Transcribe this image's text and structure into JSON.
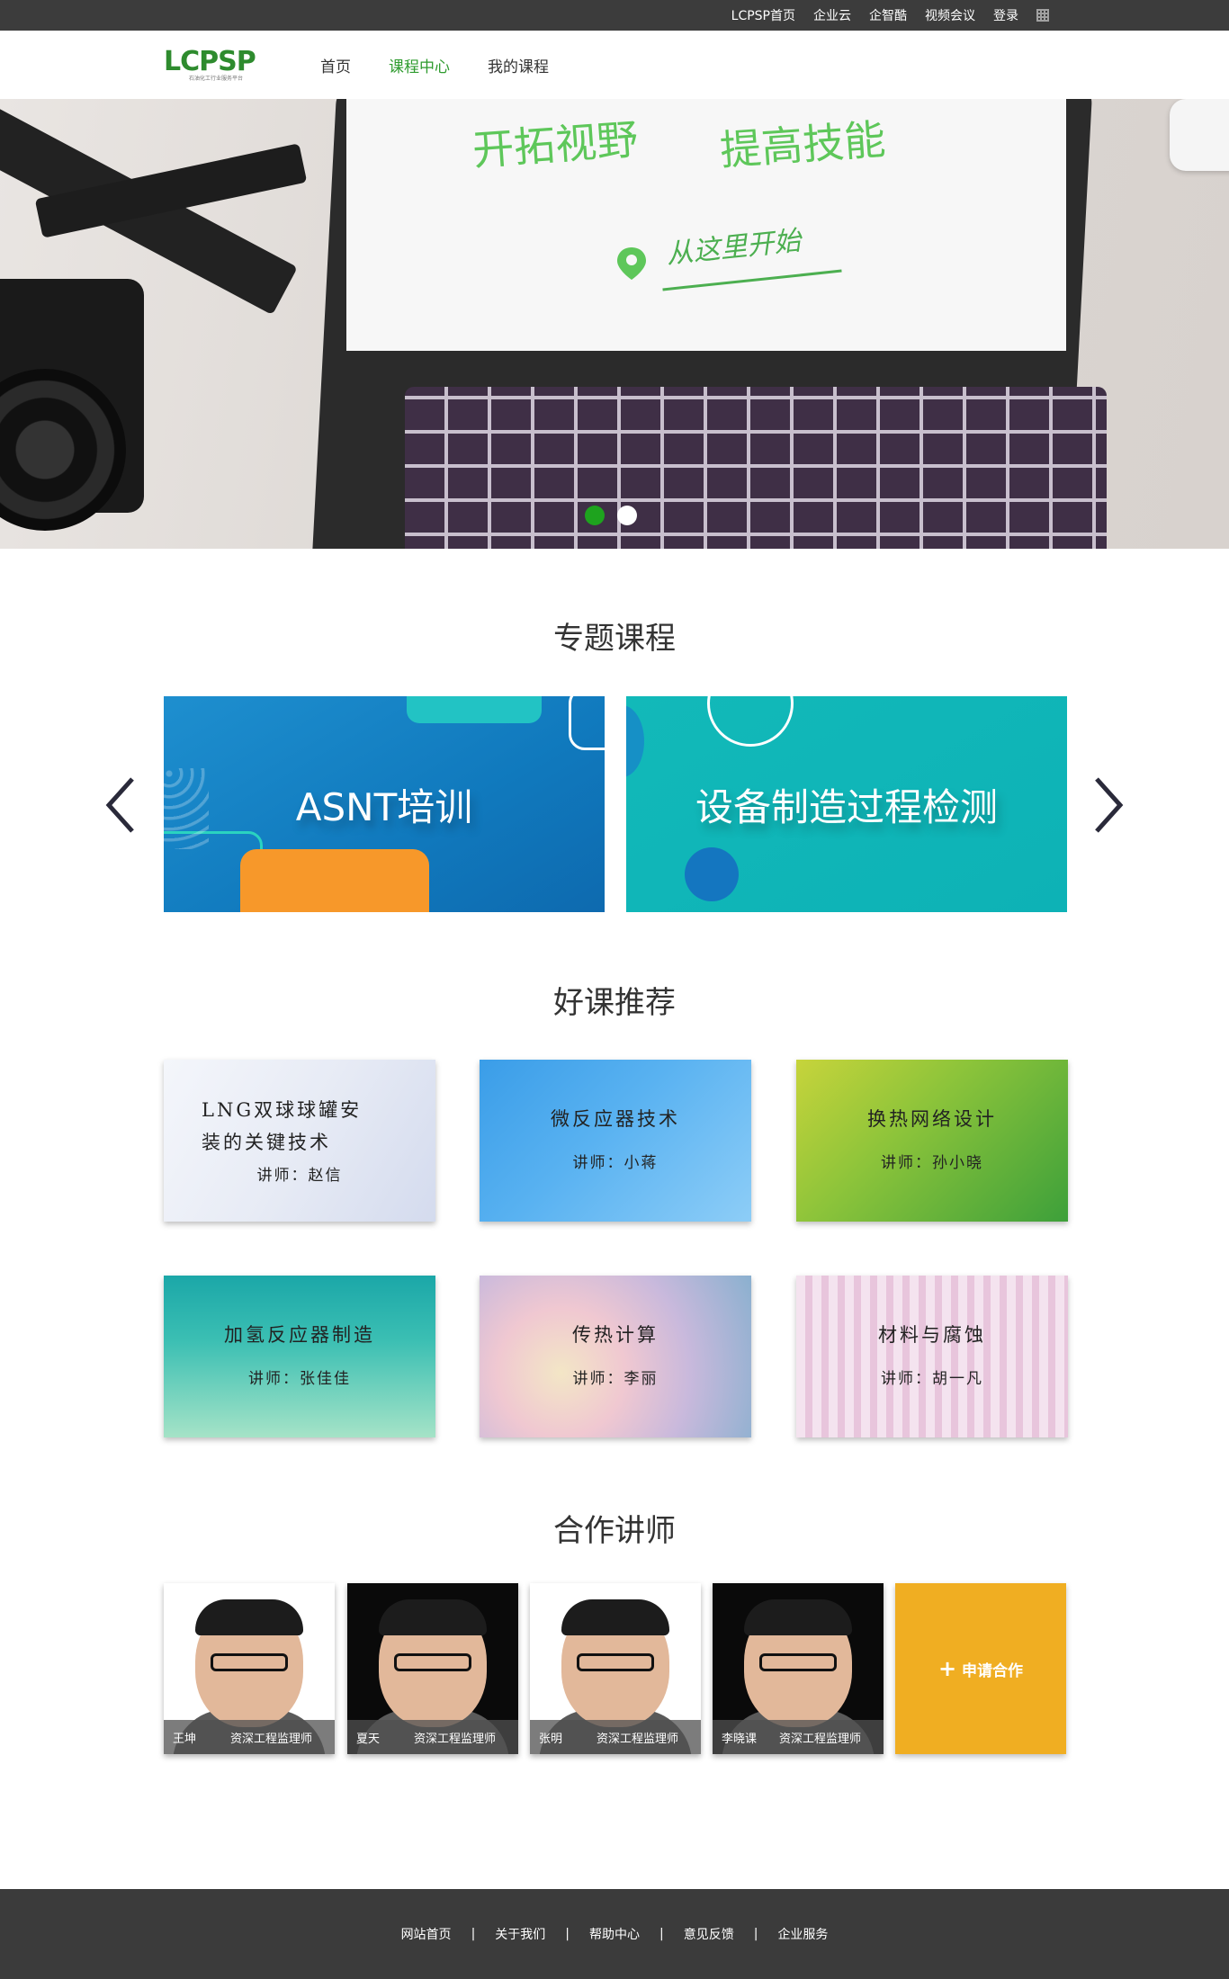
{
  "topbar": {
    "links": [
      "LCPSP首页",
      "企业云",
      "企智酷",
      "视频会议",
      "登录"
    ],
    "qr_icon": "qr-code-icon"
  },
  "header": {
    "logo_text": "LCPSP",
    "logo_sub": "石油化工行业服务平台",
    "nav": [
      "首页",
      "课程中心",
      "我的课程"
    ],
    "active_nav": "课程中心"
  },
  "banner": {
    "title1": "开拓视野",
    "title2": "提高技能",
    "cta": "从这里开始",
    "accent_color": "#5ec75a",
    "dots_count": 2,
    "active_dot": 1
  },
  "topics": {
    "title": "专题课程",
    "cards": [
      "ASNT培训",
      "设备制造过程检测"
    ]
  },
  "courses": {
    "title": "好课推荐",
    "teacher_prefix": "讲师：",
    "items": [
      {
        "title": "LNG双球球罐安装的关键技术",
        "teacher": "讲师：赵信"
      },
      {
        "title": "微反应器技术",
        "teacher": "讲师：小蒋"
      },
      {
        "title": "换热网络设计",
        "teacher": "讲师：孙小晓"
      },
      {
        "title": "加氢反应器制造",
        "teacher": "讲师：张佳佳"
      },
      {
        "title": "传热计算",
        "teacher": "讲师：李丽"
      },
      {
        "title": "材料与腐蚀",
        "teacher": "讲师：胡一凡"
      }
    ]
  },
  "teachers": {
    "title": "合作讲师",
    "items": [
      {
        "name": "王坤",
        "role": "资深工程监理师"
      },
      {
        "name": "夏天",
        "role": "资深工程监理师"
      },
      {
        "name": "张明",
        "role": "资深工程监理师"
      },
      {
        "name": "李晓课",
        "role": "资深工程监理师"
      }
    ],
    "apply_label": "申请合作",
    "apply_color": "#f0ae22"
  },
  "footer": {
    "links": [
      "网站首页",
      "关于我们",
      "帮助中心",
      "意见反馈",
      "企业服务"
    ]
  }
}
